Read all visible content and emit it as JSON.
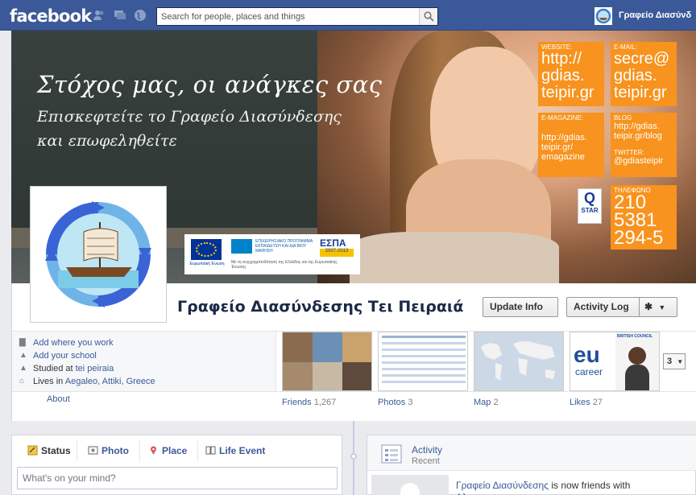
{
  "topbar": {
    "logo": "facebook",
    "search_placeholder": "Search for people, places and things",
    "user_name": "Γραφείο Διασύνδ"
  },
  "cover": {
    "slogan": "Στόχος μας, οι ανάγκες σας",
    "subline1": "Επισκεφτείτε το Γραφείο Διασύνδεσης",
    "subline2": "και επωφεληθείτε",
    "website_label": "WEBSITE:",
    "website_lines": [
      "http://",
      "gdias.",
      "teipir.gr"
    ],
    "email_label": "E-MAIL:",
    "email_lines": [
      "secre@",
      "gdias.",
      "teipir.gr"
    ],
    "emagazine_label": "E-MAGAZINE:",
    "emagazine_lines": [
      "http://gdias.",
      "teipir.gr/",
      "emagazine"
    ],
    "blog_label": "BLOG",
    "blog_lines": [
      "http://gdias.",
      "teipir.gr/blog"
    ],
    "twitter_label": "TWITTER:",
    "twitter_value": "@gdiasteipir",
    "phone_label": "ΤΗΛΕΦΩΝΟ",
    "phone_lines": [
      "210",
      "5381",
      "294-5"
    ],
    "qstar_q": "Q",
    "qstar_s": "STAR",
    "eu_caption": "Ευρωπαϊκή Ένωση",
    "eu_program": "ΕΠΙΧΕΙΡΗΣΙΑΚΟ ΠΡΟΓΡΑΜΜΑ ΕΚΠΑΙΔΕΥΣΗ ΚΑΙ ΔΙΑ ΒΙΟΥ ΜΑΘΗΣΗ",
    "espa": "ΕΣΠΑ",
    "espa_years": "2007-2013",
    "eu_footer": "Με τη συγχρηματοδότηση της Ελλάδας και της Ευρωπαϊκής Ένωσης"
  },
  "identity": {
    "page_name": "Γραφείο Διασύνδεσης Τει Πειραιά",
    "update_info": "Update Info",
    "activity_log": "Activity Log"
  },
  "about": {
    "work": "Add where you work",
    "school": "Add your school",
    "studied_prefix": "Studied at ",
    "studied_value": "tei peiraia",
    "lives_prefix": "Lives in ",
    "lives_value": "Aegaleo, Attiki, Greece",
    "about_link": "About"
  },
  "tiles": {
    "friends_label": "Friends",
    "friends_count": "1,267",
    "photos_label": "Photos",
    "photos_count": "3",
    "map_label": "Map",
    "map_count": "2",
    "likes_label": "Likes",
    "likes_count": "27",
    "likes_logo": "eu",
    "likes_logo_sub": "career",
    "likes_brand": "BRITISH COUNCIL",
    "more_count": "3"
  },
  "publisher": {
    "status": "Status",
    "photo": "Photo",
    "place": "Place",
    "life_event": "Life Event",
    "placeholder": "What's on your mind?"
  },
  "activity": {
    "title": "Activity",
    "subtitle": "Recent",
    "text_actor": "Γραφείο Διασύνδεσης",
    "text_rest": " is now friends with",
    "text_line2": "Αλ"
  },
  "colors": {
    "fb_blue": "#3b5998",
    "cover_orange": "#f7931e"
  }
}
